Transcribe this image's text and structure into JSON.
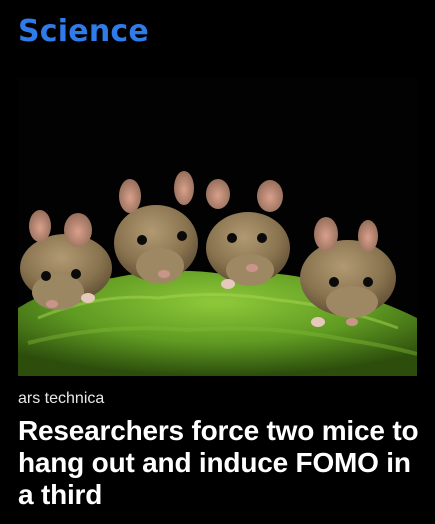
{
  "section": {
    "title": "Science",
    "accent_color": "#2f7bea"
  },
  "article": {
    "source": "ars technica",
    "headline": "Researchers force two mice to hang out and induce FOMO in a third",
    "image_icon": "photo-four-mice-on-moss"
  }
}
